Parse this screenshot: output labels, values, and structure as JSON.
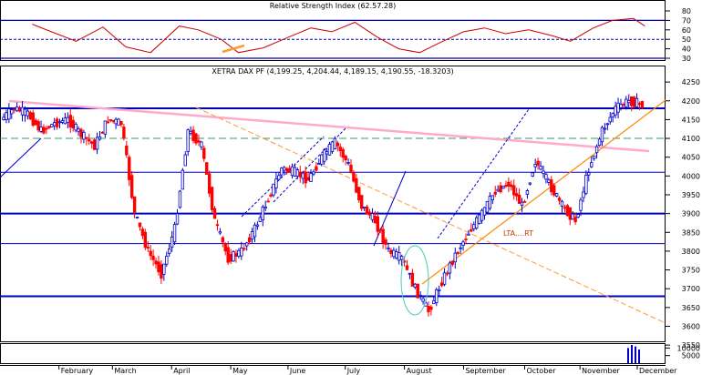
{
  "chart_data": [
    {
      "type": "line",
      "title": "Relative Strength Index (62.57.28)",
      "ylim": [
        30,
        80
      ],
      "y_ticks": [
        "30",
        "40",
        "50",
        "60",
        "70",
        "80"
      ],
      "reference_levels": {
        "solid": [
          30,
          70
        ],
        "dashed": [
          50
        ]
      },
      "series": [
        {
          "color": "#cc0000",
          "x": [
            "2005-01-18",
            "2005-01-28",
            "2005-02-10",
            "2005-02-24",
            "2005-03-08",
            "2005-03-21",
            "2005-04-05",
            "2005-04-15",
            "2005-04-27",
            "2005-05-06",
            "2005-05-19",
            "2005-06-01",
            "2005-06-13",
            "2005-06-24",
            "2005-07-06",
            "2005-07-18",
            "2005-07-29",
            "2005-08-09",
            "2005-08-19",
            "2005-09-01",
            "2005-09-12",
            "2005-09-23",
            "2005-10-05",
            "2005-10-17",
            "2005-10-27",
            "2005-11-08",
            "2005-11-18",
            "2005-11-29",
            "2005-12-05"
          ],
          "values": [
            66,
            58,
            48,
            63,
            42,
            36,
            64,
            60,
            50,
            36,
            41,
            52,
            62,
            58,
            68,
            52,
            40,
            36,
            46,
            58,
            62,
            56,
            60,
            54,
            48,
            62,
            70,
            72,
            64
          ]
        }
      ]
    },
    {
      "type": "line",
      "title": "XETRA DAX PF (4,199.25, 4,204.44, 4,189.15, 4,190.55, -18.3203)",
      "ylim": [
        3560,
        4260
      ],
      "y_ticks": [
        "3550",
        "3600",
        "3650",
        "3700",
        "3750",
        "3800",
        "3850",
        "3900",
        "3950",
        "4000",
        "4050",
        "4100",
        "4150",
        "4200",
        "4250"
      ],
      "x_labels": [
        "February",
        "March",
        "April",
        "May",
        "June",
        "July",
        "August",
        "September",
        "October",
        "November",
        "December"
      ],
      "candle_colors": {
        "up": "#0000cc",
        "down": "#ff0000"
      },
      "series": [
        {
          "name": "",
          "x": [
            "2005-01-03",
            "2005-01-10",
            "2005-01-17",
            "2005-01-24",
            "2005-01-31",
            "2005-02-07",
            "2005-02-14",
            "2005-02-21",
            "2005-02-28",
            "2005-03-07",
            "2005-03-14",
            "2005-03-21",
            "2005-03-28",
            "2005-04-04",
            "2005-04-11",
            "2005-04-18",
            "2005-04-25",
            "2005-05-02",
            "2005-05-09",
            "2005-05-16",
            "2005-05-23",
            "2005-05-30",
            "2005-06-06",
            "2005-06-13",
            "2005-06-20",
            "2005-06-27",
            "2005-07-04",
            "2005-07-11",
            "2005-07-18",
            "2005-07-25",
            "2005-08-01",
            "2005-08-08",
            "2005-08-15",
            "2005-08-22",
            "2005-08-29",
            "2005-09-05",
            "2005-09-12",
            "2005-09-19",
            "2005-09-26",
            "2005-10-03",
            "2005-10-10",
            "2005-10-17",
            "2005-10-24",
            "2005-10-31",
            "2005-11-07",
            "2005-11-14",
            "2005-11-21",
            "2005-11-28",
            "2005-12-05"
          ],
          "values": [
            4150,
            4180,
            4165,
            4120,
            4140,
            4150,
            4110,
            4080,
            4150,
            4140,
            3900,
            3800,
            3740,
            3860,
            4120,
            4080,
            3880,
            3780,
            3800,
            3860,
            3940,
            4020,
            4010,
            3990,
            4050,
            4090,
            4030,
            3920,
            3880,
            3800,
            3780,
            3700,
            3640,
            3720,
            3790,
            3850,
            3900,
            3960,
            3980,
            3920,
            4040,
            3980,
            3920,
            3880,
            4020,
            4120,
            4180,
            4200,
            4190
          ]
        }
      ],
      "annotations": [
        "LTA....RT"
      ],
      "horizontal_levels": {
        "blue_solid": [
          4180,
          4010,
          3900,
          3820,
          3680
        ],
        "green_dashed": [
          4100
        ]
      },
      "trendlines": [
        "pink descending resistance",
        "orange dashed descending",
        "orange ascending support"
      ]
    },
    {
      "type": "bar",
      "title": "",
      "y_ticks": [
        "5000",
        "10000"
      ],
      "values": [
        10000,
        12000,
        11000,
        9000
      ]
    }
  ]
}
